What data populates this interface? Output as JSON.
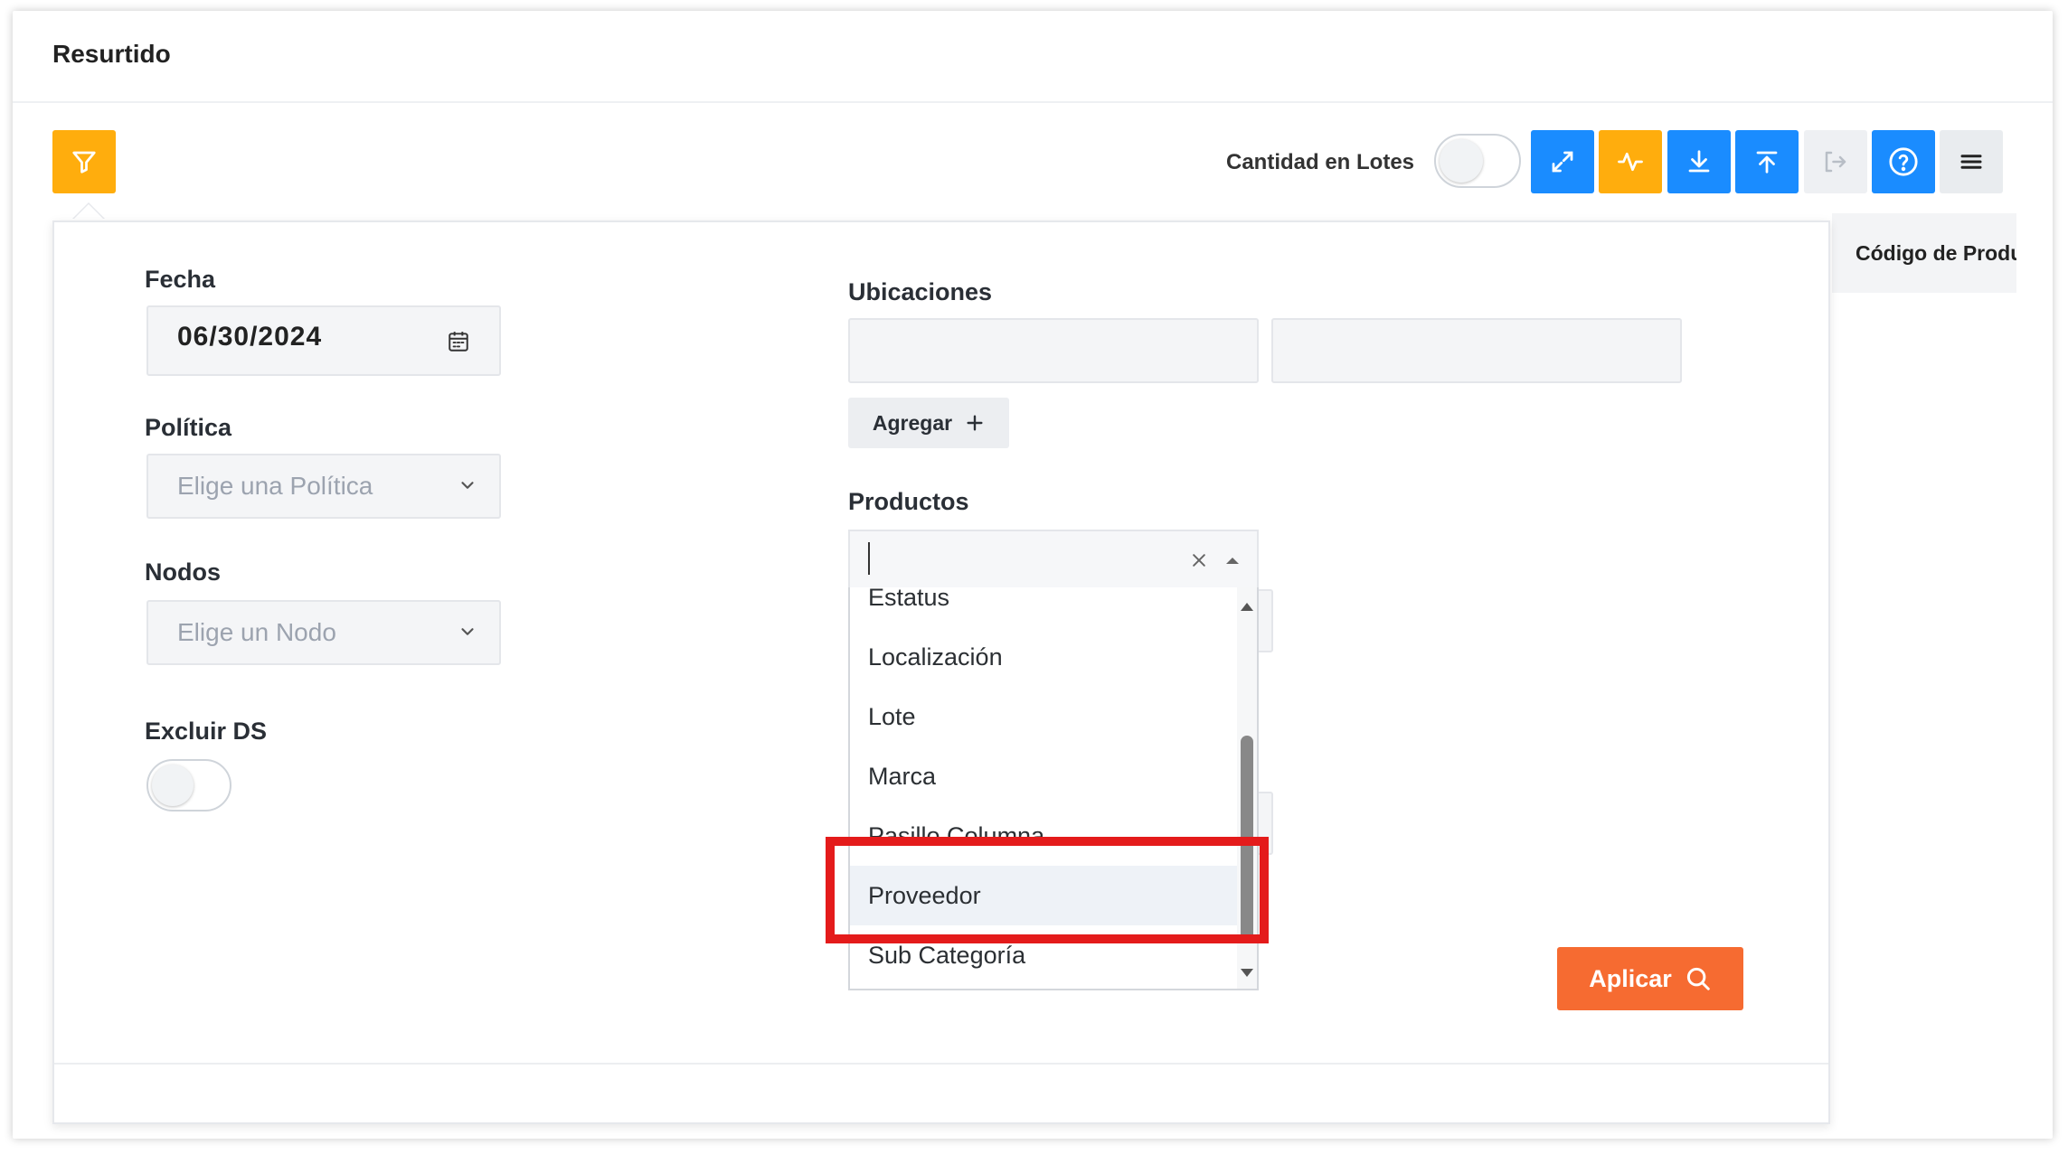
{
  "page": {
    "title": "Resurtido"
  },
  "toolbar": {
    "lot_quantity_label": "Cantidad en Lotes",
    "lot_quantity_on": false,
    "buttons": [
      "filter-icon",
      "expand-icon",
      "pulse-icon",
      "download-icon",
      "upload-icon",
      "exit-icon",
      "help-icon",
      "menu-icon"
    ]
  },
  "table": {
    "column_header": "Código de Produ"
  },
  "filters": {
    "date": {
      "label": "Fecha",
      "value": "06/30/2024"
    },
    "policy": {
      "label": "Política",
      "placeholder": "Elige una Política"
    },
    "nodes": {
      "label": "Nodos",
      "placeholder": "Elige un Nodo"
    },
    "exclude_ds": {
      "label": "Excluir DS",
      "on": false
    },
    "locations": {
      "label": "Ubicaciones",
      "add_label": "Agregar"
    },
    "products": {
      "label": "Productos",
      "value": "",
      "options": [
        "Estatus",
        "Localización",
        "Lote",
        "Marca",
        "Pasillo Columna",
        "Proveedor",
        "Sub Categoría"
      ],
      "highlighted": "Proveedor"
    },
    "apply_label": "Aplicar"
  },
  "colors": {
    "accent_blue": "#1a8cff",
    "accent_yellow": "#ffad0d",
    "apply_orange": "#f66b31",
    "annotation_red": "#e41b1b"
  }
}
